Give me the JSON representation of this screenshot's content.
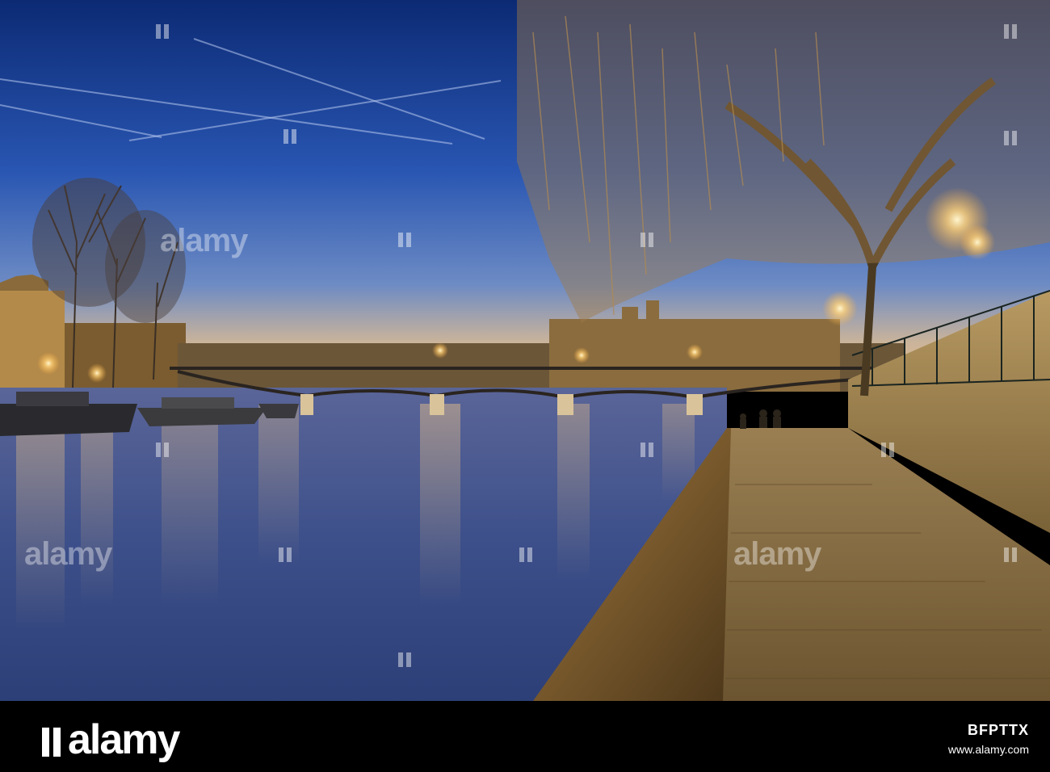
{
  "photo": {
    "description_colors": {
      "sky_top": "#0d2c78",
      "sky_mid": "#2c5ab8",
      "sky_horizon": "#e9c59a",
      "water": "#3d4f8a",
      "light": "#ffd27a"
    }
  },
  "watermarks": {
    "text": "alamy",
    "icon": "alamy-logo-icon"
  },
  "footer": {
    "brand": "alamy",
    "image_id": "BFPTTX",
    "site": "www.alamy.com"
  }
}
